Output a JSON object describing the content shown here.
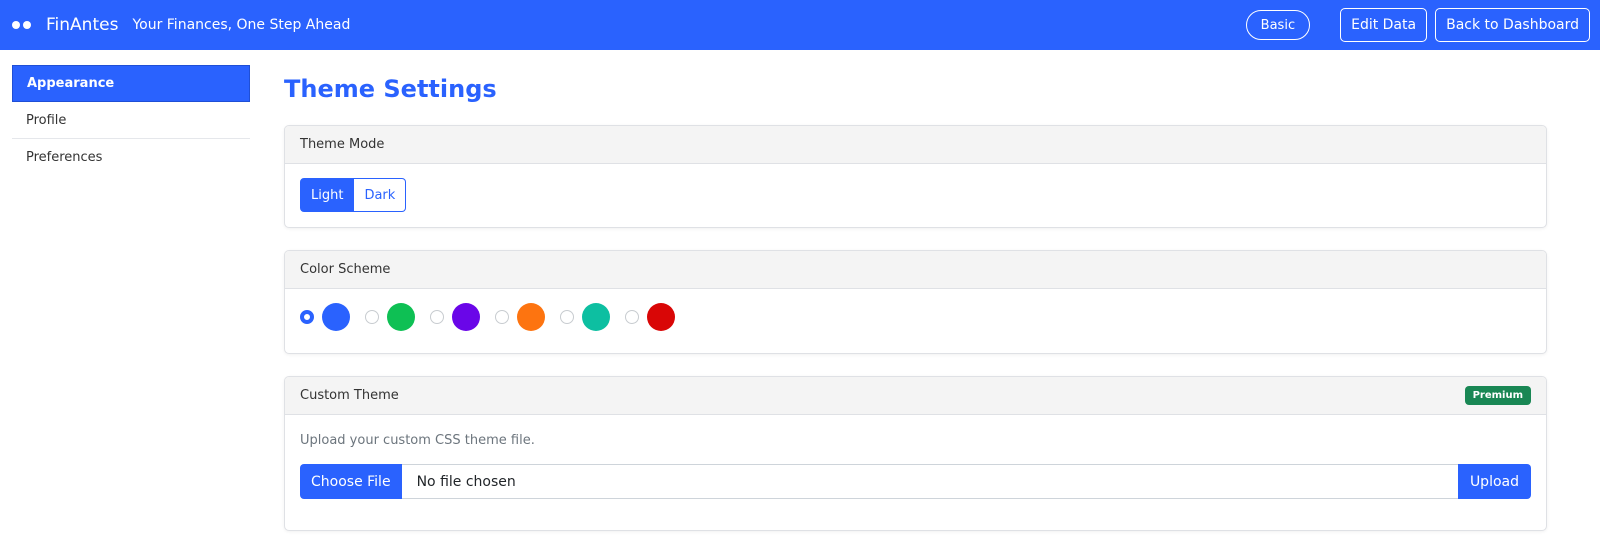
{
  "brand": {
    "name": "FinAntes",
    "tagline": "Your Finances, One Step Ahead"
  },
  "nav": {
    "plan_label": "Basic",
    "edit_label": "Edit Data",
    "back_label": "Back to Dashboard"
  },
  "sidebar": {
    "items": [
      {
        "label": "Appearance",
        "active": true
      },
      {
        "label": "Profile",
        "active": false
      },
      {
        "label": "Preferences",
        "active": false
      }
    ]
  },
  "page": {
    "title": "Theme Settings"
  },
  "theme_mode": {
    "header": "Theme Mode",
    "options": [
      "Light",
      "Dark"
    ],
    "selected": "Light"
  },
  "color_scheme": {
    "header": "Color Scheme",
    "swatches": [
      "#2a62fe",
      "#0ec054",
      "#6a06e8",
      "#fd7410",
      "#0dbfa1",
      "#d90606"
    ],
    "selected_index": 0
  },
  "custom_theme": {
    "header": "Custom Theme",
    "badge": "Premium",
    "help_text": "Upload your custom CSS theme file.",
    "choose_label": "Choose File",
    "file_status": "No file chosen",
    "upload_label": "Upload"
  },
  "colors": {
    "accent": "#2a62fe",
    "badge": "#198754"
  }
}
